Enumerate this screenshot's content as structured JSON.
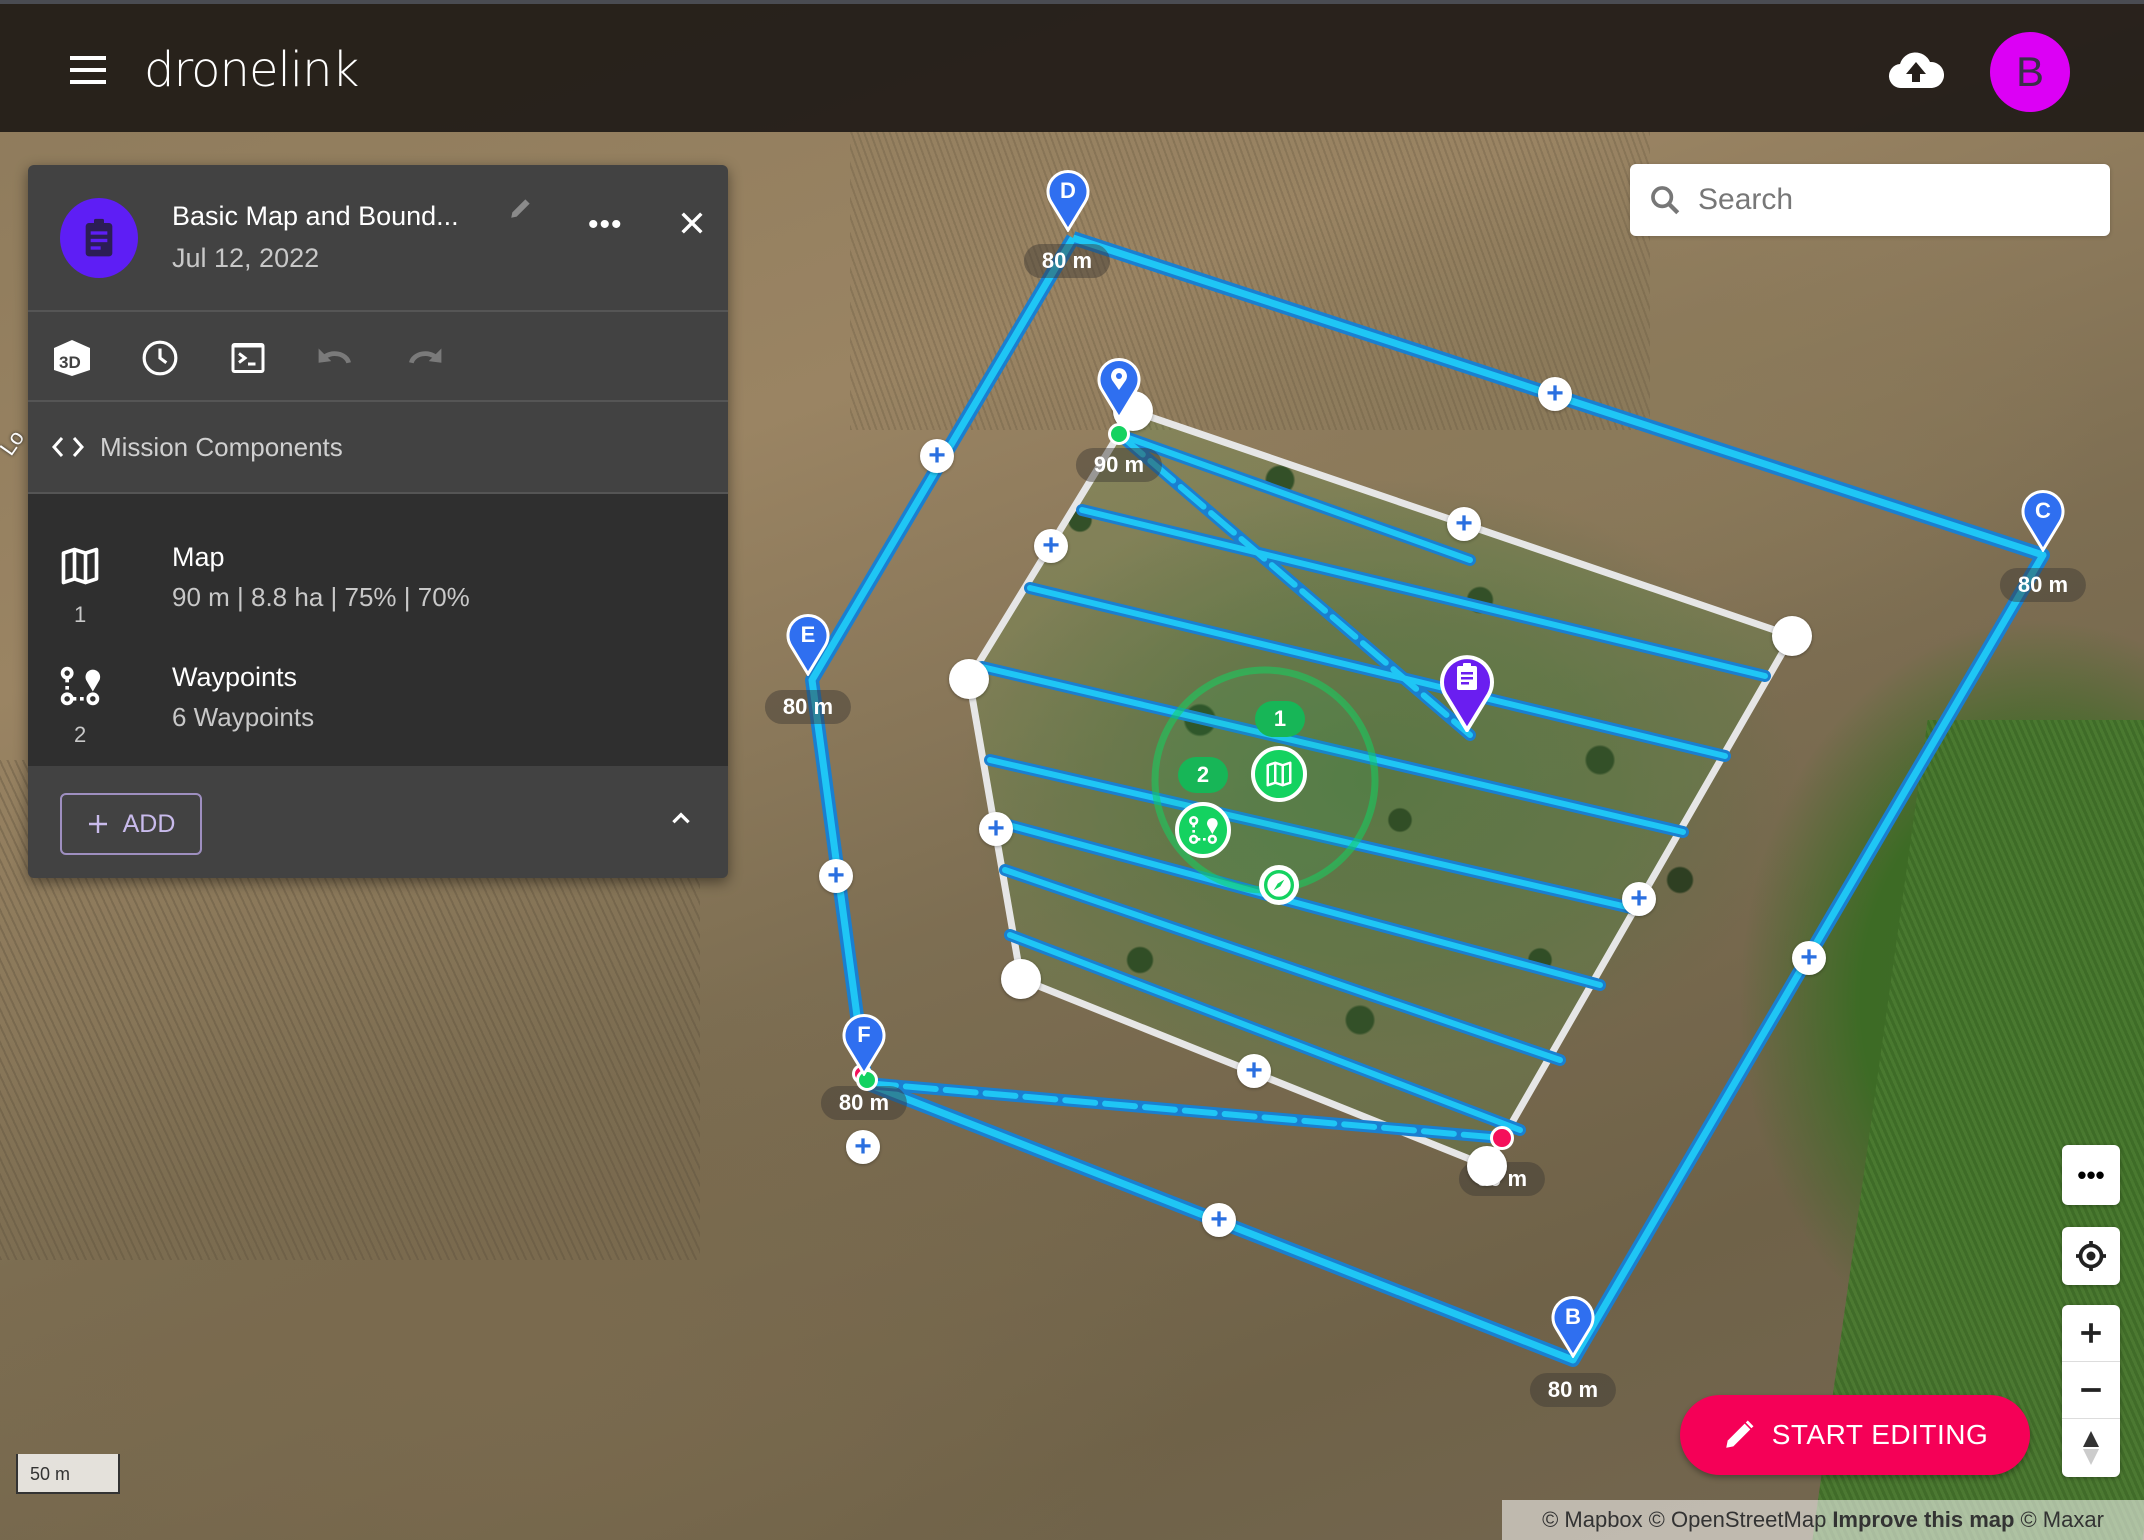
{
  "app": {
    "name": "dronelink",
    "user_initial": "B",
    "avatar_color": "#dc00f5"
  },
  "header": {
    "menu_icon": "menu-icon",
    "upload_icon": "cloud-upload-icon"
  },
  "panel": {
    "plan_icon": "clipboard-icon",
    "title": "Basic Map and Bound...",
    "date": "Jul 12, 2022",
    "edit_icon": "pencil-icon",
    "more_label": "•••",
    "close_icon": "close-icon",
    "toolbar": [
      {
        "name": "3d-view",
        "icon": "3d-icon",
        "enabled": true
      },
      {
        "name": "history",
        "icon": "clock-icon",
        "enabled": true
      },
      {
        "name": "console",
        "icon": "terminal-icon",
        "enabled": true
      },
      {
        "name": "undo",
        "icon": "undo-icon",
        "enabled": false
      },
      {
        "name": "redo",
        "icon": "redo-icon",
        "enabled": false
      }
    ],
    "section_label": "Mission Components",
    "components": [
      {
        "index": "1",
        "title": "Map",
        "subtitle": "90 m | 8.8 ha | 75% | 70%",
        "icon": "map-icon"
      },
      {
        "index": "2",
        "title": "Waypoints",
        "subtitle": "6 Waypoints",
        "icon": "waypoints-icon"
      }
    ],
    "add_label": "ADD",
    "collapse_icon": "chevron-up-icon"
  },
  "search": {
    "placeholder": "Search",
    "value": ""
  },
  "map": {
    "road_label": "Lo",
    "waypoints": [
      {
        "letter": "D",
        "altitude": "80 m"
      },
      {
        "letter": "C",
        "altitude": "80 m"
      },
      {
        "letter": "B",
        "altitude": "80 m"
      },
      {
        "letter": "E",
        "altitude": "80 m"
      },
      {
        "letter": "F",
        "altitude": "80 m"
      }
    ],
    "map_start_altitude": "90 m",
    "map_end_altitude": "90 m",
    "component_badges": [
      "1",
      "2"
    ],
    "colors": {
      "path": "#1fc6f5",
      "path_outline": "#1a7fd0",
      "waypoint": "#2f6ff0",
      "component": "#14d260",
      "plan_pin": "#6a1ef0",
      "start_dot": "#14d260",
      "end_dot": "#f5105a"
    }
  },
  "controls": {
    "more_label": "•••",
    "locate_icon": "locate-icon",
    "zoom_in_icon": "plus-icon",
    "zoom_out_icon": "minus-icon",
    "compass_icon": "compass-north-icon"
  },
  "start_editing_label": "START EDITING",
  "scale_label": "50 m",
  "attribution": {
    "mapbox": "© Mapbox",
    "osm": "© OpenStreetMap",
    "improve": "Improve this map",
    "maxar": "© Maxar"
  }
}
